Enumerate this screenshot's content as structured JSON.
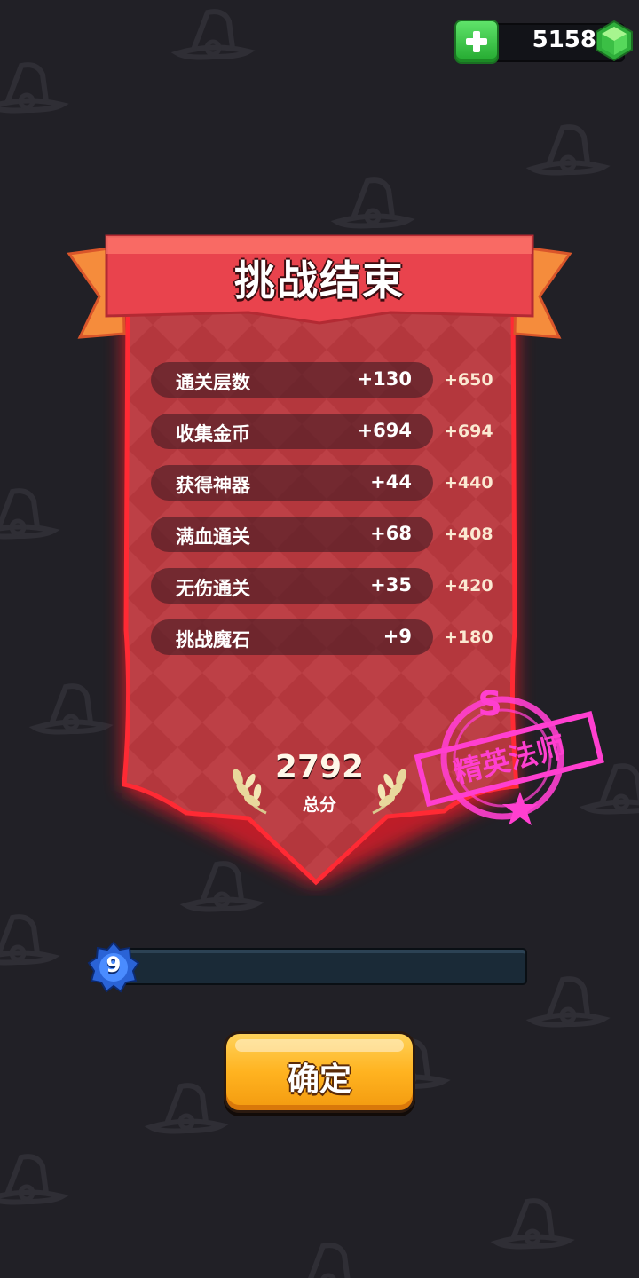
{
  "currency": {
    "gems": "5158",
    "add_icon": "plus-icon",
    "gem_icon": "green-gem-icon",
    "gem_color": "#37c843"
  },
  "panel": {
    "title": "挑战结束",
    "rows": [
      {
        "label": "通关层数",
        "value": "+130",
        "points": "+650"
      },
      {
        "label": "收集金币",
        "value": "+694",
        "points": "+694"
      },
      {
        "label": "获得神器",
        "value": "+44",
        "points": "+440"
      },
      {
        "label": "满血通关",
        "value": "+68",
        "points": "+408"
      },
      {
        "label": "无伤通关",
        "value": "+35",
        "points": "+420"
      },
      {
        "label": "挑战魔石",
        "value": "+9",
        "points": "+180"
      }
    ],
    "total": {
      "score": "2792",
      "label": "总分"
    }
  },
  "rank_stamp": {
    "grade": "S",
    "title": "精英法师",
    "color": "#ff3fd0"
  },
  "level": {
    "number": "9",
    "progress": 0.0
  },
  "confirm_button": {
    "label": "确定"
  },
  "colors": {
    "background": "#212026",
    "banner_red": "#b9393e",
    "ribbon": "#e8424c",
    "button": "#ffb320"
  }
}
